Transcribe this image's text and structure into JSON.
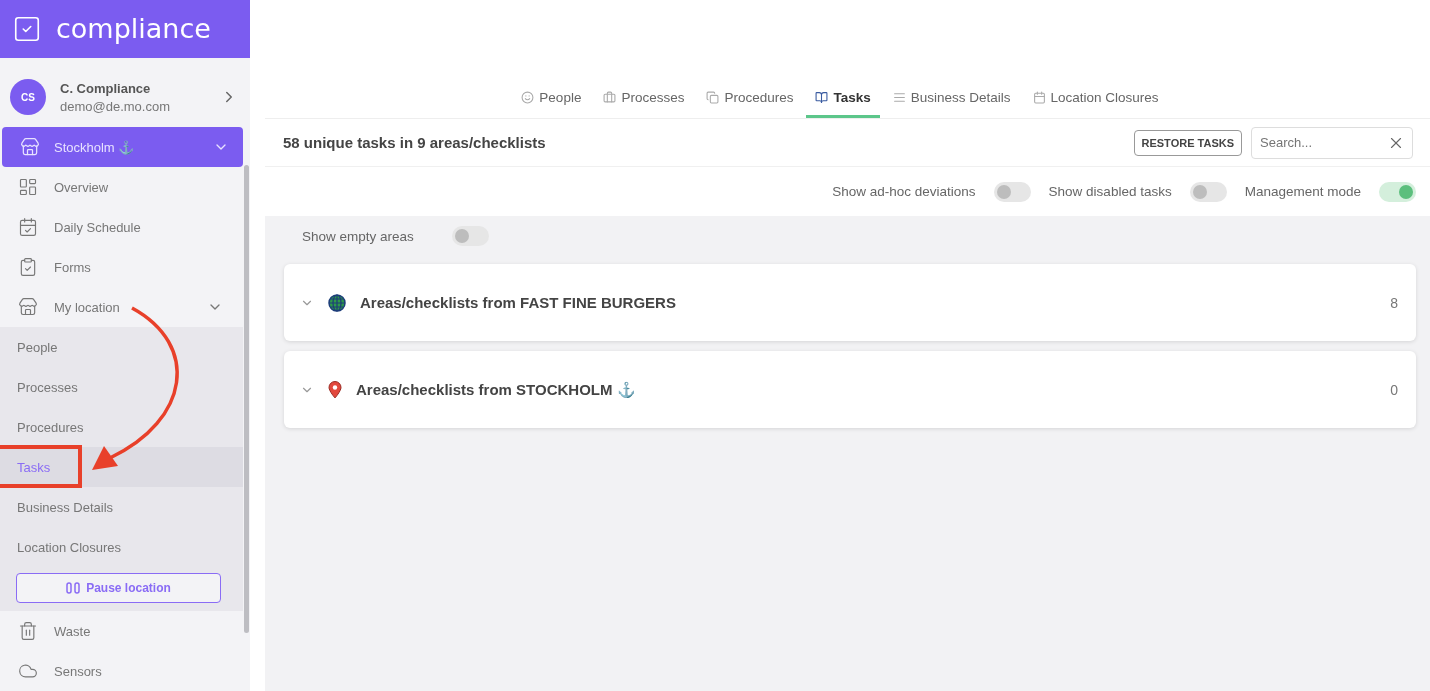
{
  "sidebar": {
    "logo": "compliance",
    "user": {
      "initials": "CS",
      "name": "C. Compliance",
      "email": "demo@de.mo.com"
    },
    "location": {
      "label": "Stockholm ⚓",
      "expanded": true
    },
    "items": [
      {
        "label": "Overview"
      },
      {
        "label": "Daily Schedule"
      },
      {
        "label": "Forms"
      },
      {
        "label": "My location",
        "expanded": true,
        "children": [
          {
            "label": "People",
            "selected": false
          },
          {
            "label": "Processes",
            "selected": false
          },
          {
            "label": "Procedures",
            "selected": false
          },
          {
            "label": "Tasks",
            "selected": true
          },
          {
            "label": "Business Details",
            "selected": false
          },
          {
            "label": "Location Closures",
            "selected": false
          }
        ],
        "action": "Pause location"
      },
      {
        "label": "Waste"
      },
      {
        "label": "Sensors"
      }
    ]
  },
  "tabs": [
    {
      "label": "People",
      "selected": false
    },
    {
      "label": "Processes",
      "selected": false
    },
    {
      "label": "Procedures",
      "selected": false
    },
    {
      "label": "Tasks",
      "selected": true
    },
    {
      "label": "Business Details",
      "selected": false
    },
    {
      "label": "Location Closures",
      "selected": false
    }
  ],
  "summary": "58 unique tasks in 9 areas/checklists",
  "restore_button": "RESTORE TASKS",
  "search": {
    "placeholder": "Search..."
  },
  "toggles": [
    {
      "label": "Show ad-hoc deviations",
      "on": false
    },
    {
      "label": "Show disabled tasks",
      "on": false
    },
    {
      "label": "Management mode",
      "on": true
    }
  ],
  "empty_areas_toggle": {
    "label": "Show empty areas",
    "on": false
  },
  "groups": [
    {
      "title": "Areas/checklists from FAST FINE BURGERS",
      "count": "8"
    },
    {
      "title": "Areas/checklists from STOCKHOLM ⚓",
      "count": "0"
    }
  ]
}
